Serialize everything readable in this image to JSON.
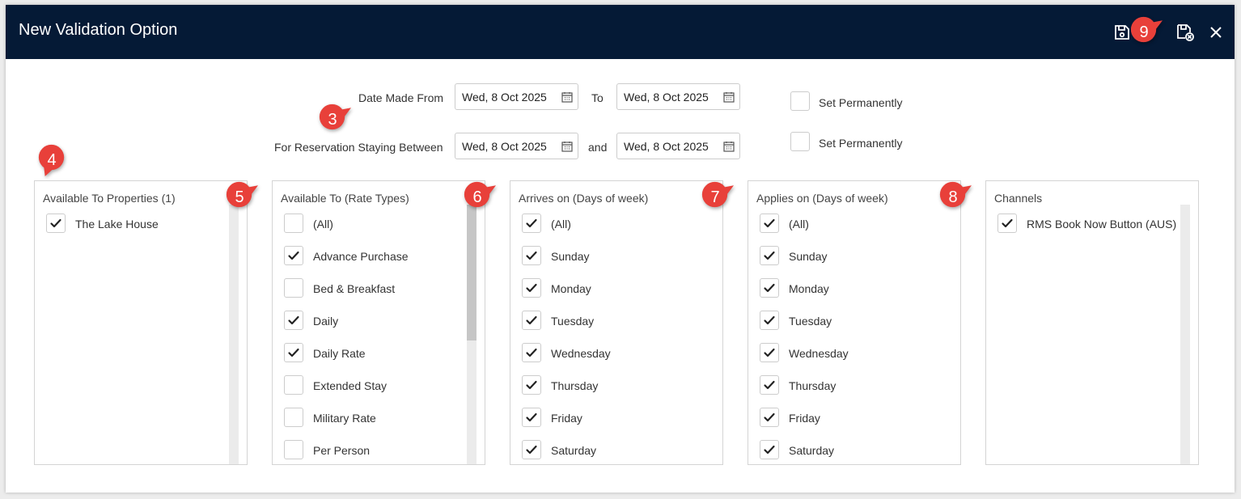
{
  "window": {
    "title": "New Validation Option"
  },
  "toolbar": {
    "save_icon": "save-icon",
    "save_close_icon": "save-close-icon",
    "close_icon": "close-icon"
  },
  "dates": {
    "date_made_from_label": "Date Made From",
    "date_made_from": "Wed, 8 Oct 2025",
    "to_label": "To",
    "date_made_to": "Wed, 8 Oct 2025",
    "staying_label": "For Reservation Staying Between",
    "staying_from": "Wed, 8 Oct 2025",
    "and_label": "and",
    "staying_to": "Wed, 8 Oct 2025",
    "set_permanently_1": "Set Permanently",
    "set_permanently_2": "Set Permanently",
    "set_permanently_1_checked": false,
    "set_permanently_2_checked": false
  },
  "markers": [
    "3",
    "4",
    "5",
    "6",
    "7",
    "8",
    "9"
  ],
  "marker_color": "#e8403a",
  "panels": {
    "properties": {
      "title": "Available To Properties (1)",
      "items": [
        {
          "label": "The Lake House",
          "checked": true
        }
      ]
    },
    "rate_types": {
      "title": "Available To (Rate Types)",
      "items": [
        {
          "label": "(All)",
          "checked": false
        },
        {
          "label": "Advance Purchase",
          "checked": true
        },
        {
          "label": "Bed & Breakfast",
          "checked": false
        },
        {
          "label": "Daily",
          "checked": true
        },
        {
          "label": "Daily Rate",
          "checked": true
        },
        {
          "label": "Extended Stay",
          "checked": false
        },
        {
          "label": "Military Rate",
          "checked": false
        },
        {
          "label": "Per Person",
          "checked": false
        }
      ]
    },
    "arrives_on": {
      "title": "Arrives on (Days of week)",
      "items": [
        {
          "label": "(All)",
          "checked": true
        },
        {
          "label": "Sunday",
          "checked": true
        },
        {
          "label": "Monday",
          "checked": true
        },
        {
          "label": "Tuesday",
          "checked": true
        },
        {
          "label": "Wednesday",
          "checked": true
        },
        {
          "label": "Thursday",
          "checked": true
        },
        {
          "label": "Friday",
          "checked": true
        },
        {
          "label": "Saturday",
          "checked": true
        }
      ]
    },
    "applies_on": {
      "title": "Applies on (Days of week)",
      "items": [
        {
          "label": "(All)",
          "checked": true
        },
        {
          "label": "Sunday",
          "checked": true
        },
        {
          "label": "Monday",
          "checked": true
        },
        {
          "label": "Tuesday",
          "checked": true
        },
        {
          "label": "Wednesday",
          "checked": true
        },
        {
          "label": "Thursday",
          "checked": true
        },
        {
          "label": "Friday",
          "checked": true
        },
        {
          "label": "Saturday",
          "checked": true
        }
      ]
    },
    "channels": {
      "title": "Channels",
      "items": [
        {
          "label": "RMS Book Now Button (AUS)",
          "checked": true
        }
      ]
    }
  }
}
